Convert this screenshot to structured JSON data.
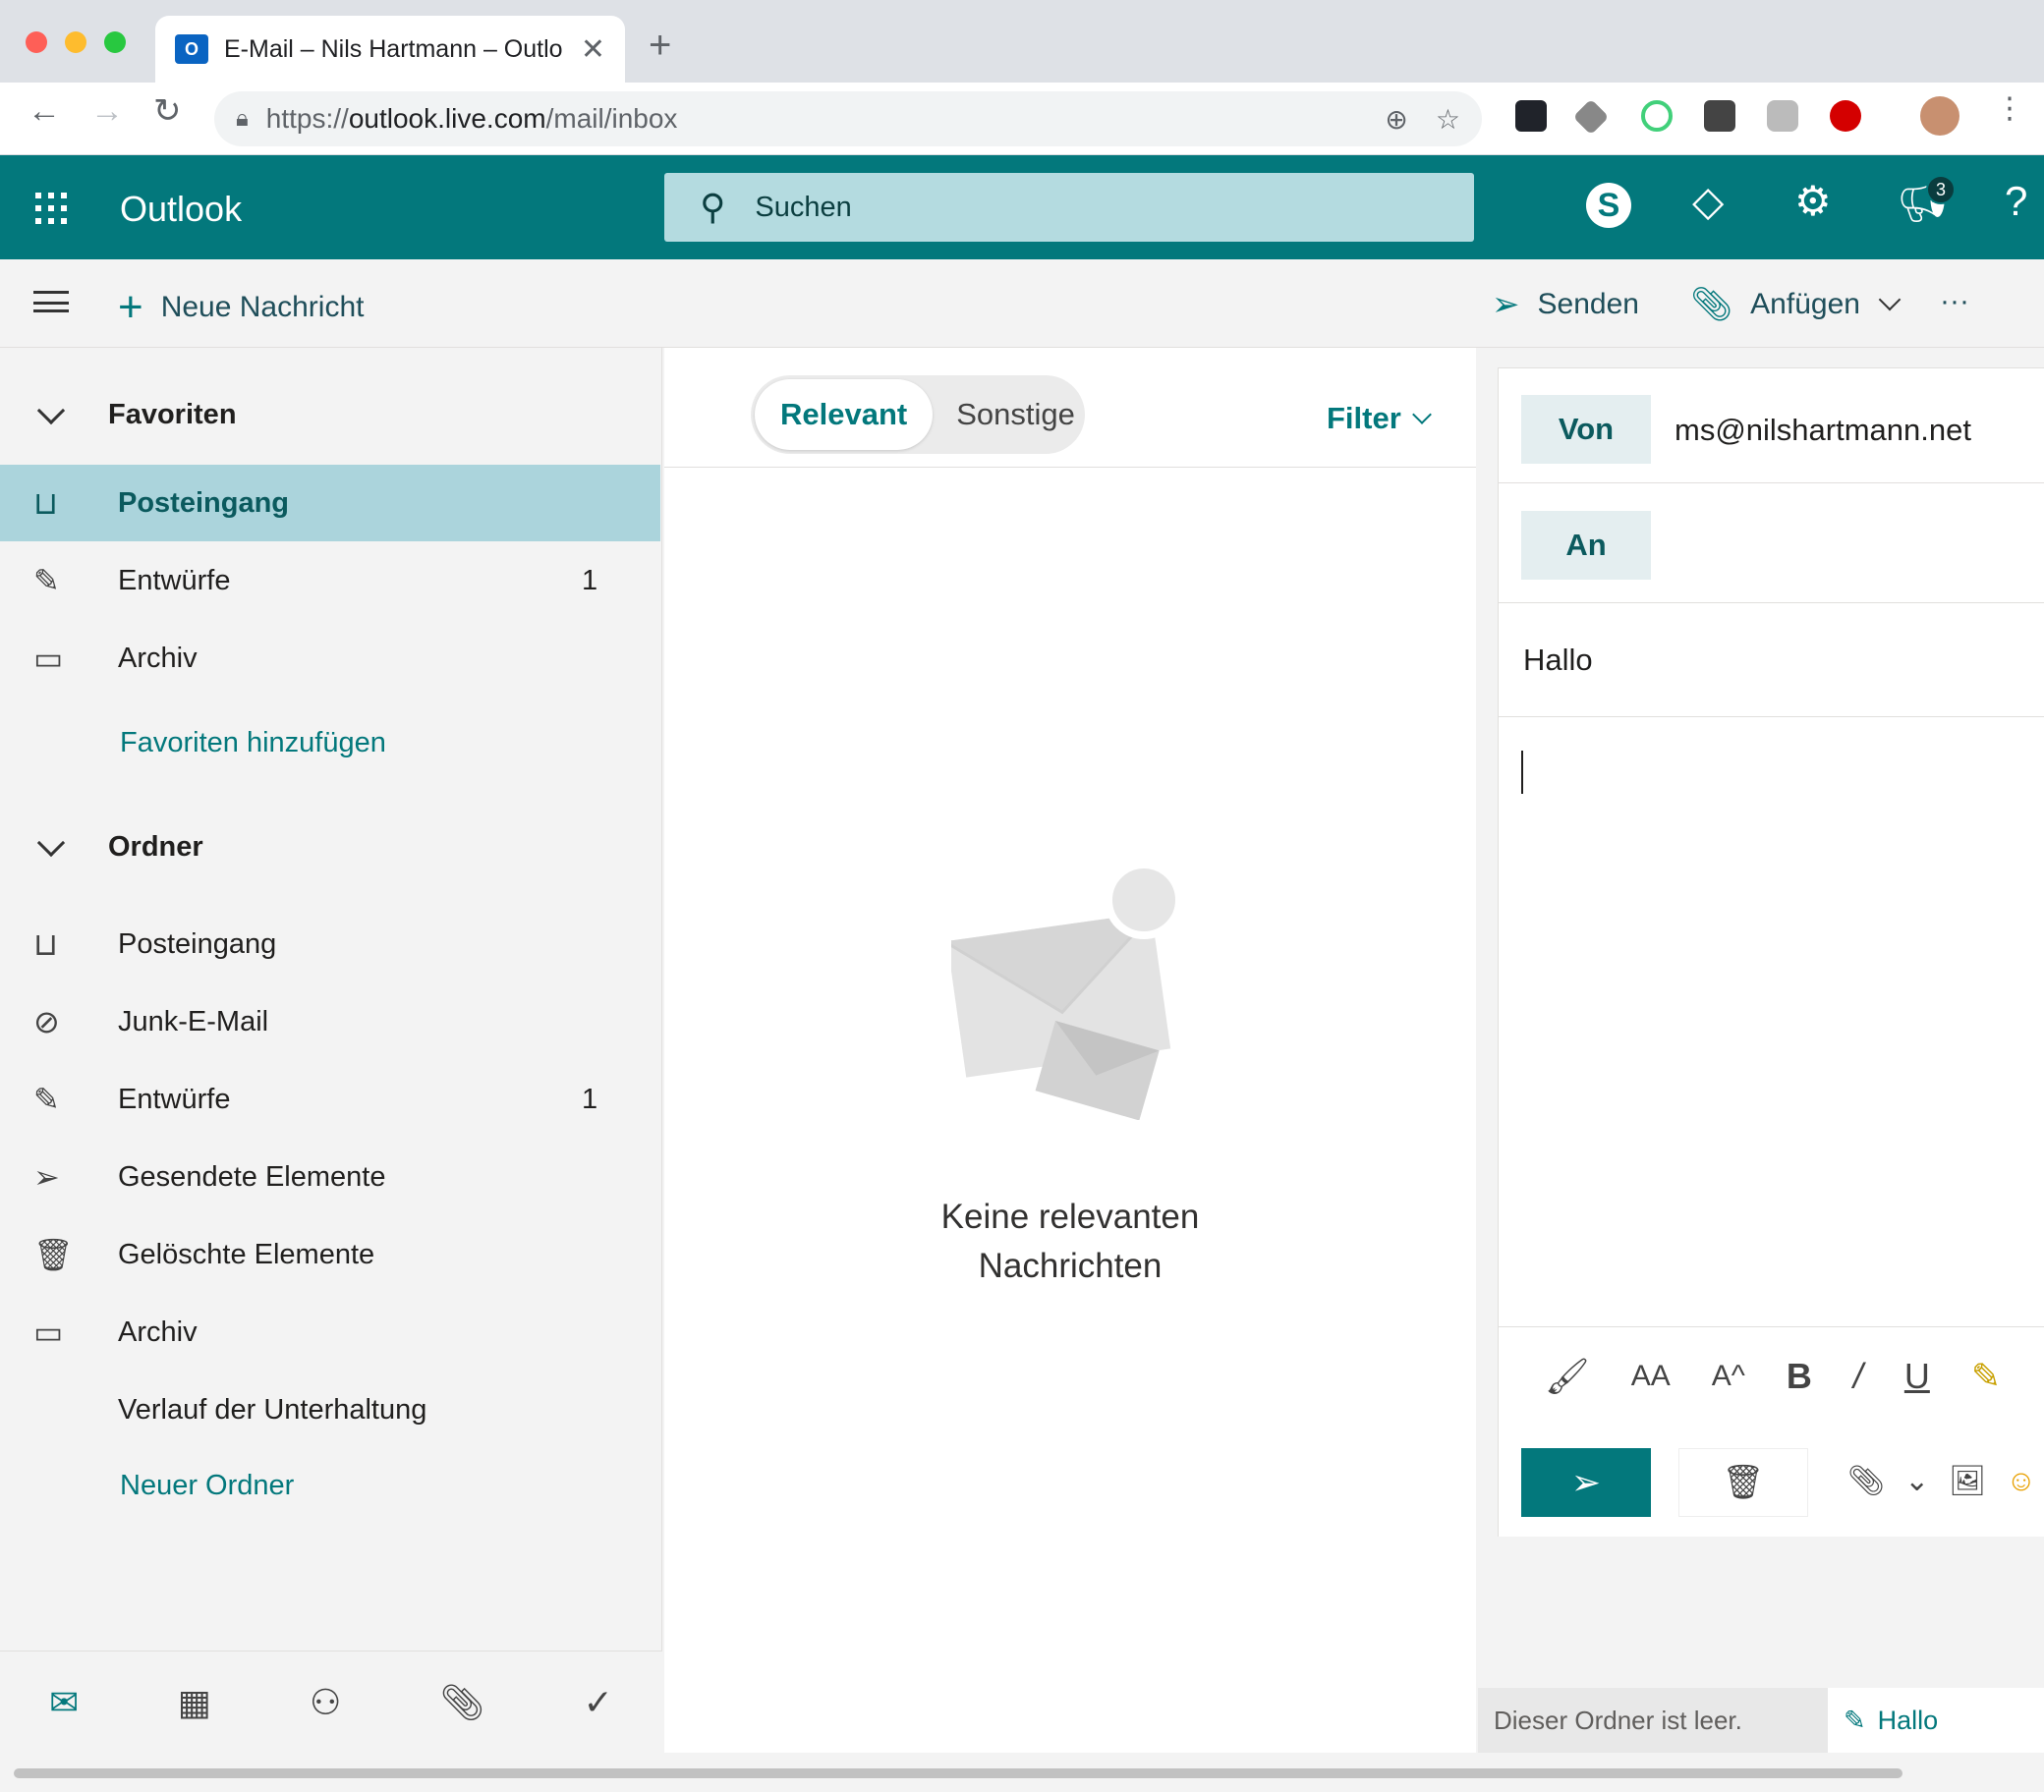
{
  "browser": {
    "tab_title": "E-Mail – Nils Hartmann – Outlo",
    "tab_favicon": "O",
    "url_prefix": "https://",
    "url_host": "outlook.live.com",
    "url_path": "/mail/inbox"
  },
  "header": {
    "app_name": "Outlook",
    "search_placeholder": "Suchen",
    "notification_count": "3",
    "accent_color": "#03787c"
  },
  "commandbar": {
    "new_message": "Neue Nachricht",
    "send": "Senden",
    "attach": "Anfügen",
    "more": "···"
  },
  "sidebar": {
    "favorites_header": "Favoriten",
    "favorites": [
      {
        "label": "Posteingang",
        "count": "",
        "icon": "inbox-icon",
        "selected": true
      },
      {
        "label": "Entwürfe",
        "count": "1",
        "icon": "pencil-icon"
      },
      {
        "label": "Archiv",
        "count": "",
        "icon": "archive-icon"
      }
    ],
    "add_favorite": "Favoriten hinzufügen",
    "folders_header": "Ordner",
    "folders": [
      {
        "label": "Posteingang",
        "count": "",
        "icon": "inbox-icon"
      },
      {
        "label": "Junk-E-Mail",
        "count": "",
        "icon": "block-icon"
      },
      {
        "label": "Entwürfe",
        "count": "1",
        "icon": "pencil-icon"
      },
      {
        "label": "Gesendete Elemente",
        "count": "",
        "icon": "send-icon"
      },
      {
        "label": "Gelöschte Elemente",
        "count": "",
        "icon": "trash-icon"
      },
      {
        "label": "Archiv",
        "count": "",
        "icon": "archive-icon"
      },
      {
        "label": "Verlauf der Unterhaltung",
        "count": "",
        "icon": ""
      }
    ],
    "new_folder": "Neuer Ordner"
  },
  "messagelist": {
    "tab_focused": "Relevant",
    "tab_other": "Sonstige",
    "filter": "Filter",
    "empty_line1": "Keine relevanten",
    "empty_line2": "Nachrichten"
  },
  "compose": {
    "from_label": "Von",
    "from_value": "ms@nilshartmann.net",
    "to_label": "An",
    "subject": "Hallo"
  },
  "status": {
    "folder_empty": "Dieser Ordner ist leer.",
    "draft_tab": "Hallo"
  }
}
